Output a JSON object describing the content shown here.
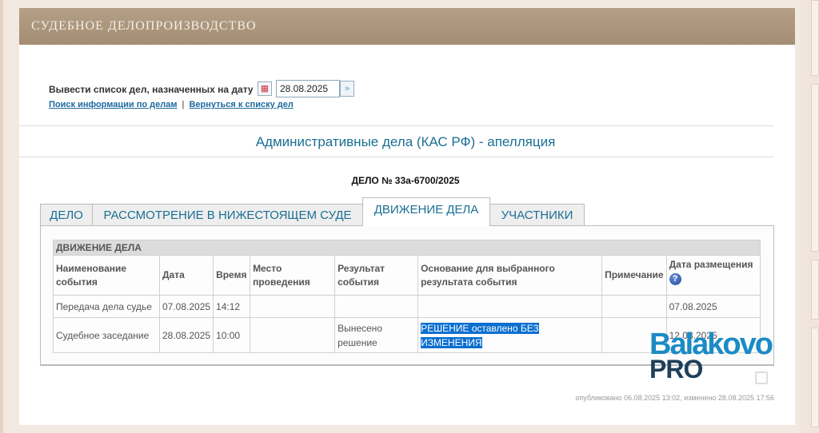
{
  "header": {
    "title": "СУДЕБНОЕ ДЕЛОПРОИЗВОДСТВО"
  },
  "date_filter": {
    "label": "Вывести список дел, назначенных на дату",
    "value": "28.08.2025"
  },
  "links": {
    "search": "Поиск информации по делам",
    "separator": "|",
    "back": "Вернуться к списку дел"
  },
  "page_title": "Административные дела (КАС РФ) - апелляция",
  "case_number": "ДЕЛО № 33а-6700/2025",
  "tabs": [
    {
      "label": "ДЕЛО"
    },
    {
      "label": "РАССМОТРЕНИЕ В НИЖЕСТОЯЩЕМ СУДЕ"
    },
    {
      "label": "ДВИЖЕНИЕ ДЕЛА",
      "active": true
    },
    {
      "label": "УЧАСТНИКИ"
    }
  ],
  "table": {
    "caption": "ДВИЖЕНИЕ ДЕЛА",
    "headers": [
      "Наименование события",
      "Дата",
      "Время",
      "Место проведения",
      "Результат события",
      "Основание для выбранного результата события",
      "Примечание",
      "Дата размещения"
    ],
    "rows": [
      [
        "Передача дела судье",
        "07.08.2025",
        "14:12",
        "",
        "",
        "",
        "",
        "07.08.2025"
      ],
      [
        "Судебное заседание",
        "28.08.2025",
        "10:00",
        "",
        "Вынесено решение",
        "РЕШЕНИЕ оставлено БЕЗ ИЗМЕНЕНИЯ",
        "",
        "12.08.2025"
      ]
    ]
  },
  "footer": "опубликовано 06.08.2025 13:02, изменено 28.08.2025 17:56",
  "watermark": {
    "line1": "Balakovo",
    "line2": "PRO"
  }
}
